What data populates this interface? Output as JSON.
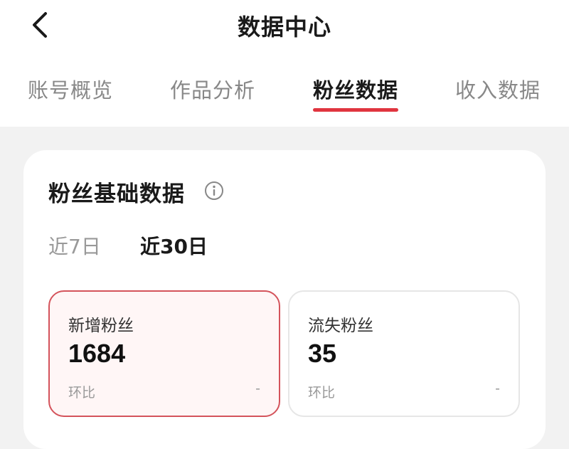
{
  "header": {
    "title": "数据中心",
    "back_icon": "chevron-left-icon"
  },
  "tabs": [
    {
      "label": "账号概览",
      "active": false
    },
    {
      "label": "作品分析",
      "active": false
    },
    {
      "label": "粉丝数据",
      "active": true
    },
    {
      "label": "收入数据",
      "active": false
    }
  ],
  "colors": {
    "accent": "#e0353f",
    "selected_border": "#d4535b",
    "selected_bg": "#fff6f6",
    "page_bg": "#f2f2f2"
  },
  "card": {
    "title": "粉丝基础数据",
    "info_icon": "info-circle-icon",
    "ranges": [
      {
        "label": "近7日",
        "active": false
      },
      {
        "label": "近30日",
        "active": true
      }
    ],
    "metrics": [
      {
        "label": "新增粉丝",
        "value": "1684",
        "compare_label": "环比",
        "compare_value": "-",
        "selected": true
      },
      {
        "label": "流失粉丝",
        "value": "35",
        "compare_label": "环比",
        "compare_value": "-",
        "selected": false
      }
    ]
  }
}
